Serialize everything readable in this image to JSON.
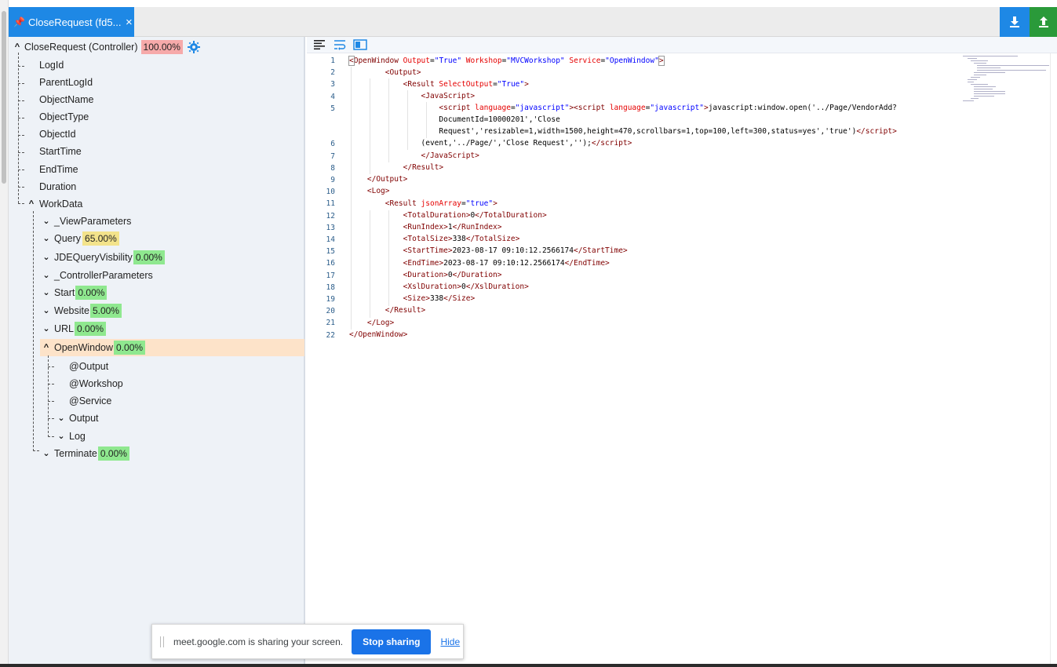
{
  "tab": {
    "title": "CloseRequest (fd5...",
    "close_icon": "×"
  },
  "toolbar": {
    "download": "download-icon",
    "upload": "upload-icon",
    "download_color": "#1e88e5",
    "upload_color": "#2a9a3a"
  },
  "tree": {
    "root": {
      "label": "CloseRequest (Controller)",
      "badge": "100.00%"
    },
    "fields": [
      "LogId",
      "ParentLogId",
      "ObjectName",
      "ObjectType",
      "ObjectId",
      "StartTime",
      "EndTime",
      "Duration"
    ],
    "workdata": {
      "label": "WorkData"
    },
    "children": [
      {
        "label": "_ViewParameters",
        "badge": ""
      },
      {
        "label": "Query",
        "badge": "65.00%"
      },
      {
        "label": "JDEQueryVisbility",
        "badge": "0.00%"
      },
      {
        "label": "_ControllerParameters",
        "badge": ""
      },
      {
        "label": "Start",
        "badge": "0.00%"
      },
      {
        "label": "Website",
        "badge": "5.00%"
      },
      {
        "label": "URL",
        "badge": "0.00%"
      },
      {
        "label": "OpenWindow",
        "badge": "0.00%"
      }
    ],
    "openwindow_children": [
      "@Output",
      "@Workshop",
      "@Service",
      "Output",
      "Log"
    ],
    "terminate": {
      "label": "Terminate",
      "badge": "0.00%"
    }
  },
  "editor": {
    "line_numbers": [
      "1",
      "2",
      "3",
      "4",
      "5",
      "6",
      "7",
      "8",
      "9",
      "10",
      "11",
      "12",
      "13",
      "14",
      "15",
      "16",
      "17",
      "18",
      "19",
      "20",
      "21",
      "22"
    ]
  },
  "share": {
    "message": "meet.google.com is sharing your screen.",
    "stop": "Stop sharing",
    "hide": "Hide"
  }
}
